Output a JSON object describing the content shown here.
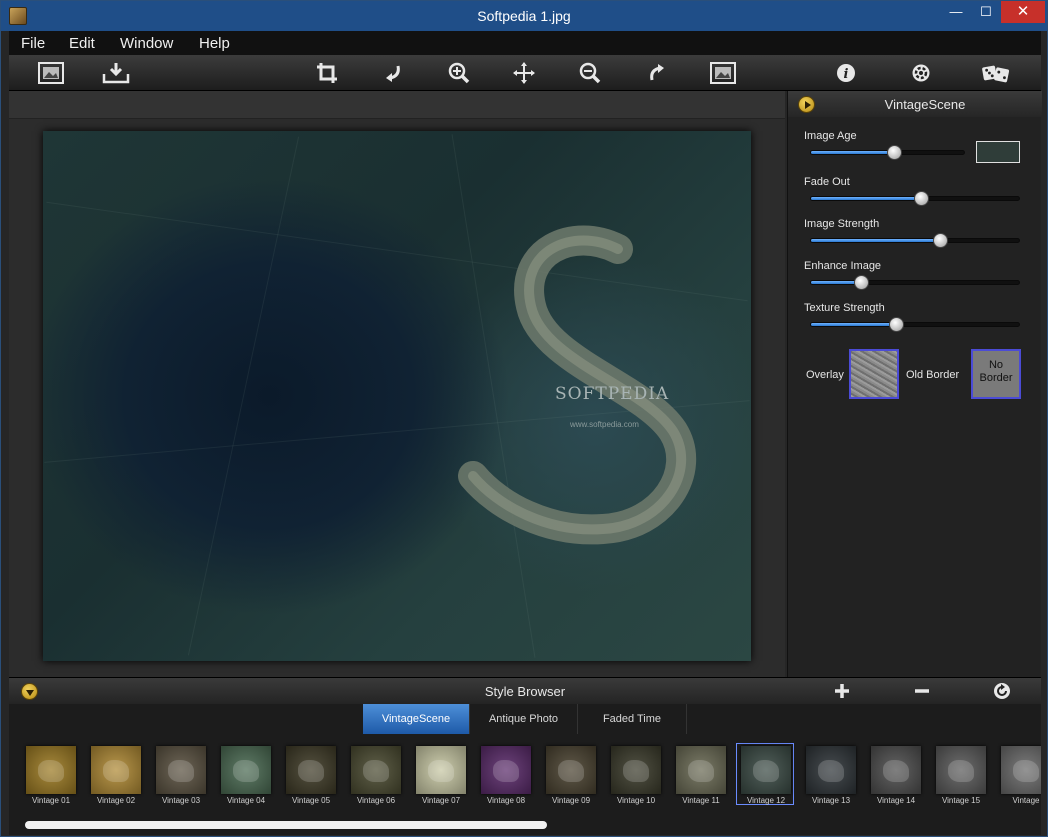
{
  "window": {
    "title": "Softpedia 1.jpg",
    "min_glyph": "—",
    "max_glyph": "☐",
    "close_glyph": "✕"
  },
  "menu": [
    "File",
    "Edit",
    "Window",
    "Help"
  ],
  "toolbar": {
    "icons": [
      "open-image-icon",
      "save-download-icon",
      "crop-icon",
      "rotate-left-icon",
      "zoom-in-icon",
      "pan-move-icon",
      "zoom-out-icon",
      "rotate-right-icon",
      "fit-image-icon",
      "info-icon",
      "settings-icon",
      "random-dice-icon"
    ]
  },
  "canvas": {
    "watermark": "SOFTPEDIA",
    "watermark_url": "www.softpedia.com"
  },
  "panel": {
    "title": "VintageScene",
    "sliders": [
      {
        "label": "Image Age",
        "value": 0.54
      },
      {
        "label": "Fade Out",
        "value": 0.53
      },
      {
        "label": "Image Strength",
        "value": 0.62
      },
      {
        "label": "Enhance Image",
        "value": 0.24
      },
      {
        "label": "Texture Strength",
        "value": 0.41
      }
    ],
    "age_color": "#2f3d39",
    "overlay_label": "Overlay",
    "old_border_label": "Old Border",
    "no_border_label": "No Border"
  },
  "style_browser": {
    "title": "Style Browser",
    "tabs": [
      {
        "label": "VintageScene",
        "active": true
      },
      {
        "label": "Antique Photo",
        "active": false
      },
      {
        "label": "Faded Time",
        "active": false
      }
    ],
    "presets": [
      {
        "label": "Vintage 01",
        "color": "#9c7a22"
      },
      {
        "label": "Vintage 02",
        "color": "#b08a34"
      },
      {
        "label": "Vintage 03",
        "color": "#5a5140"
      },
      {
        "label": "Vintage 04",
        "color": "#4a6a52"
      },
      {
        "label": "Vintage 05",
        "color": "#3e3a26"
      },
      {
        "label": "Vintage 06",
        "color": "#4a4a30"
      },
      {
        "label": "Vintage 07",
        "color": "#c8c8a4"
      },
      {
        "label": "Vintage 08",
        "color": "#5a2a6a"
      },
      {
        "label": "Vintage 09",
        "color": "#4a4230"
      },
      {
        "label": "Vintage 10",
        "color": "#3a3a2a"
      },
      {
        "label": "Vintage 11",
        "color": "#6a6a54"
      },
      {
        "label": "Vintage 12",
        "color": "#3a4a44",
        "selected": true
      },
      {
        "label": "Vintage 13",
        "color": "#2e3438"
      },
      {
        "label": "Vintage 14",
        "color": "#4e4e4e"
      },
      {
        "label": "Vintage 15",
        "color": "#5a5a5a"
      },
      {
        "label": "Vintage",
        "color": "#6a6a6a"
      }
    ]
  }
}
